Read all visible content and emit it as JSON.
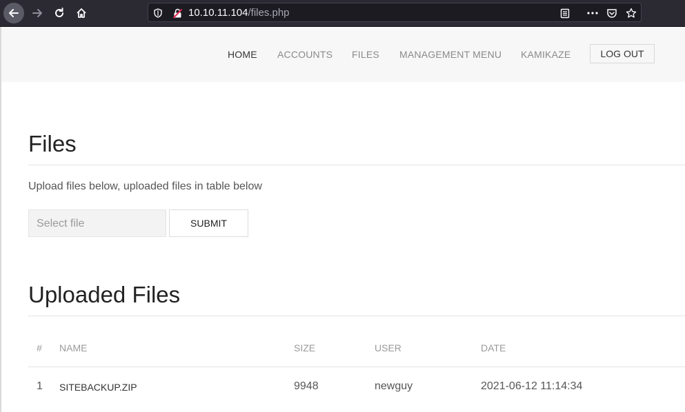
{
  "browser": {
    "url_host": "10.10.11.104",
    "url_path": "/files.php"
  },
  "nav": {
    "links": [
      "HOME",
      "ACCOUNTS",
      "FILES",
      "MANAGEMENT MENU",
      "KAMIKAZE"
    ],
    "logout_label": "LOG OUT"
  },
  "files_section": {
    "title": "Files",
    "description": "Upload files below, uploaded files in table below",
    "file_placeholder": "Select file",
    "submit_label": "SUBMIT"
  },
  "uploaded_section": {
    "title": "Uploaded Files",
    "columns": [
      "#",
      "NAME",
      "SIZE",
      "USER",
      "DATE"
    ],
    "rows": [
      [
        "1",
        "SITEBACKUP.ZIP",
        "9948",
        "newguy",
        "2021-06-12 11:14:34"
      ]
    ]
  }
}
